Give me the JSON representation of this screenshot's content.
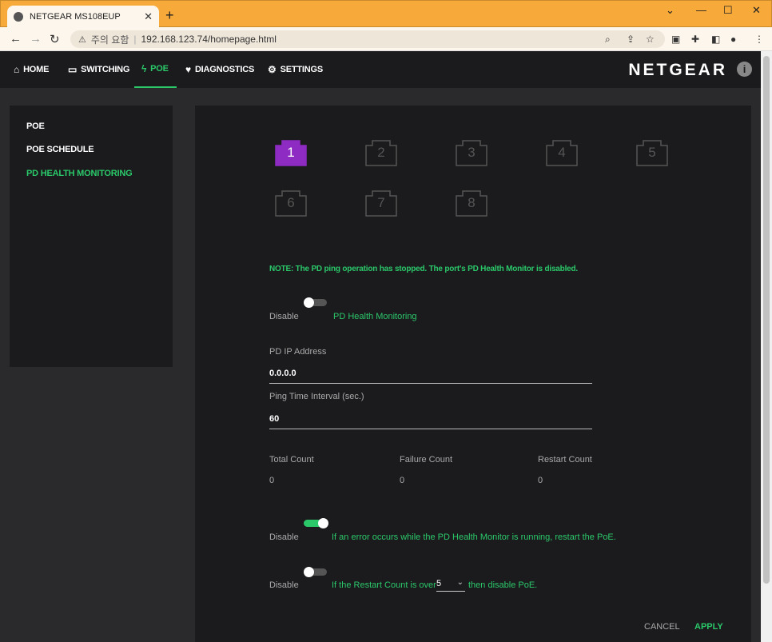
{
  "browser": {
    "tab_title": "NETGEAR MS108EUP",
    "security_label": "주의 요함",
    "url": "192.168.123.74/homepage.html"
  },
  "nav": {
    "items": [
      {
        "label": "HOME",
        "icon": "home-icon"
      },
      {
        "label": "SWITCHING",
        "icon": "switch-icon"
      },
      {
        "label": "POE",
        "icon": "lightning-icon"
      },
      {
        "label": "DIAGNOSTICS",
        "icon": "heart-icon"
      },
      {
        "label": "SETTINGS",
        "icon": "gear-icon"
      }
    ],
    "active": "POE",
    "brand": "NETGEAR"
  },
  "sidebar": {
    "items": [
      "POE",
      "POE SCHEDULE",
      "PD HEALTH MONITORING"
    ],
    "active": "PD HEALTH MONITORING"
  },
  "ports": {
    "labels": [
      "1",
      "2",
      "3",
      "4",
      "5",
      "6",
      "7",
      "8"
    ],
    "selected": "1",
    "selected_color": "#8e2bc2"
  },
  "main": {
    "note": "NOTE: The PD ping operation has stopped. The port's PD Health Monitor is disabled.",
    "health_toggle": {
      "state_label": "Disable",
      "label": "PD Health Monitoring",
      "on": false
    },
    "pd_ip": {
      "label": "PD IP Address",
      "value": "0.0.0.0"
    },
    "ping_interval": {
      "label": "Ping Time Interval (sec.)",
      "value": "60"
    },
    "counts": {
      "total_label": "Total Count",
      "total_value": "0",
      "failure_label": "Failure Count",
      "failure_value": "0",
      "restart_label": "Restart Count",
      "restart_value": "0"
    },
    "restart_toggle": {
      "state_label": "Disable",
      "label": "If an error occurs while the PD Health Monitor is running, restart the PoE.",
      "on": true
    },
    "disable_toggle": {
      "state_label": "Disable",
      "label_before": "If the Restart Count is over",
      "select_value": "5",
      "label_after": "then disable PoE.",
      "on": false
    },
    "cancel_label": "CANCEL",
    "apply_label": "APPLY"
  },
  "colors": {
    "accent": "#2bc86a",
    "browser_frame": "#f7a93a"
  }
}
